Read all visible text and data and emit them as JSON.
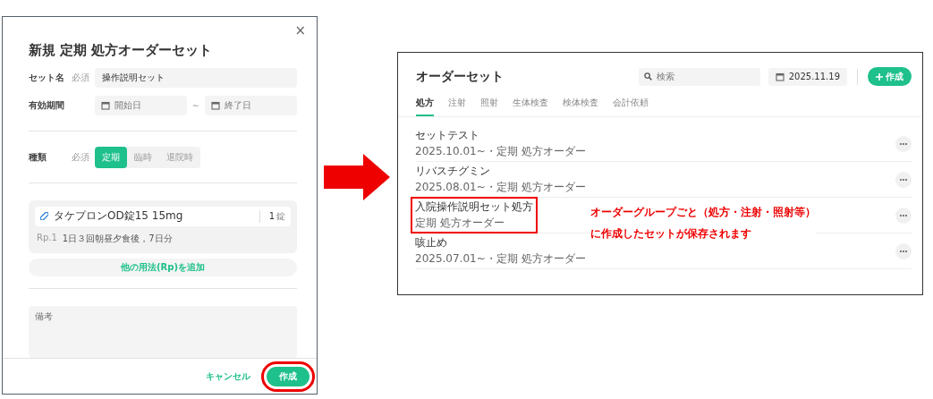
{
  "modal": {
    "title": "新規 定期 処方オーダーセット",
    "close": "×",
    "name_field": {
      "label": "セット名",
      "required": "必須",
      "value": "操作説明セット"
    },
    "period": {
      "label": "有効期間",
      "start_placeholder": "開始日",
      "separator": "～",
      "end_placeholder": "終了日"
    },
    "type": {
      "label": "種類",
      "required": "必須",
      "options": [
        {
          "label": "定期",
          "selected": true
        },
        {
          "label": "臨時",
          "selected": false
        },
        {
          "label": "退院時",
          "selected": false
        }
      ]
    },
    "prescription": {
      "drug": "タケプロンOD錠15 15mg",
      "quantity": "1",
      "unit": "錠",
      "rp": "Rp.1",
      "usage": "1日３回朝昼夕食後，7日分"
    },
    "add_button": "他の用法(Rp)を追加",
    "note": {
      "placeholder": "備考"
    },
    "cancel": "キャンセル",
    "submit": {
      "label": "作成",
      "highlighted": true
    }
  },
  "order_sets": {
    "title": "オーダーセット",
    "search": {
      "placeholder": "検索"
    },
    "date": "2025.11.19",
    "create": "作成",
    "tabs": [
      {
        "label": "処方",
        "selected": true
      },
      {
        "label": "注射",
        "selected": false
      },
      {
        "label": "照射",
        "selected": false
      },
      {
        "label": "生体検査",
        "selected": false
      },
      {
        "label": "検体検査",
        "selected": false
      },
      {
        "label": "会計依頼",
        "selected": false
      }
    ],
    "rows": [
      {
        "name": "セットテスト",
        "meta": "2025.10.01~・定期 処方オーダー",
        "highlighted": false
      },
      {
        "name": "リバスチグミン",
        "meta": "2025.08.01~・定期 処方オーダー",
        "highlighted": false
      },
      {
        "name": "入院操作説明セット処方",
        "meta": "定期 処方オーダー",
        "highlighted": true
      },
      {
        "name": "咳止め",
        "meta": "2025.07.01~・定期 処方オーダー",
        "highlighted": false
      }
    ],
    "annotation": [
      "オーダーグループごと（処方・注射・照射等）",
      "に作成したセットが保存されます"
    ]
  }
}
